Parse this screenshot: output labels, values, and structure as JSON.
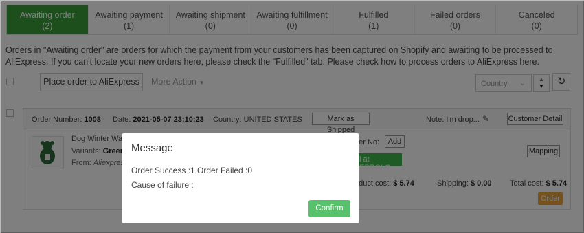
{
  "tabs": [
    {
      "label": "Awaiting order",
      "count": "(2)"
    },
    {
      "label": "Awaiting payment",
      "count": "(1)"
    },
    {
      "label": "Awaiting shipment",
      "count": "(0)"
    },
    {
      "label": "Awaiting fulfillment",
      "count": "(0)"
    },
    {
      "label": "Fulfilled",
      "count": "(1)"
    },
    {
      "label": "Failed orders",
      "count": "(0)"
    },
    {
      "label": "Canceled",
      "count": "(0)"
    }
  ],
  "intro_text": "Orders in \"Awaiting order\" are orders for which the payment from your customers has been captured on Shopify and awaiting to be processed to AliExpress. If you can't locate your new orders here, please check the \"Fulfilled\" tab. Please check how to process orders to AliExpress here.",
  "toolbar": {
    "place_order_label": "Place order to AliExpress",
    "more_action_label": "More Action",
    "country_placeholder": "Country"
  },
  "order": {
    "number_label": "Order Number:",
    "number": "1008",
    "date_label": "Date:",
    "date": "2021-05-07 23:10:23",
    "country_label": "Country:",
    "country": "UNITED STATES",
    "mark_shipped_label": "Mark as Shipped",
    "note_label": "Note:",
    "note_value": "I'm drop...",
    "customer_detail_label": "Customer Detail",
    "product_title": "Dog Winter Warm",
    "variants_label": "Variants:",
    "variants_value": "Green",
    "from_label": "From:",
    "from_value": "Aliexpress",
    "order_no_label": "der No:",
    "add_label": "Add",
    "eprolo_label": "l at EPROLO",
    "mapping_label": "Mapping",
    "product_cost_label": "oduct cost:",
    "product_cost": "$ 5.74",
    "shipping_label": "Shipping:",
    "shipping": "$ 0.00",
    "total_label": "Total cost:",
    "total": "$ 5.74",
    "order_button_label": "Order"
  },
  "modal": {
    "title": "Message",
    "result_line": "Order Success :1 Order Failed :0",
    "cause_line": "Cause of failure :",
    "confirm_label": "Confirm"
  },
  "colors": {
    "active_tab": "#3a9e3a",
    "confirm": "#57c26b",
    "order_button": "#e8a33a",
    "eprolo": "#3fb84a"
  }
}
